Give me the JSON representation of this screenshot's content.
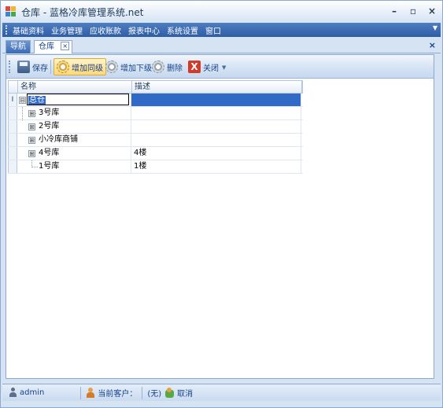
{
  "window": {
    "title": "仓库 - 蓝格冷库管理系统.net",
    "controls": {
      "minimize": "–",
      "restore": "▫",
      "close": "×"
    }
  },
  "menu": {
    "items": [
      "基础资料",
      "业务管理",
      "应收账款",
      "报表中心",
      "系统设置",
      "窗口"
    ],
    "overflow_icon": "chevron-down-icon"
  },
  "tabs": {
    "items": [
      {
        "label": "导航",
        "active": false
      },
      {
        "label": "仓库",
        "active": true
      }
    ],
    "close_glyph": "×",
    "strip_close_glyph": "×"
  },
  "toolbar": {
    "buttons": [
      {
        "label": "保存",
        "icon": "save-icon"
      },
      {
        "label": "增加同级",
        "icon": "gear-icon",
        "active": true
      },
      {
        "label": "增加下级",
        "icon": "gear-icon"
      },
      {
        "label": "删除",
        "icon": "gear-icon"
      },
      {
        "label": "关闭",
        "icon": "close-icon"
      }
    ],
    "close_glyph": "X",
    "dropdown_glyph": "▼"
  },
  "grid": {
    "columns": [
      "名称",
      "描述"
    ],
    "editing_marker": "I",
    "expander_glyph": "⊟",
    "collapsed_glyph": "⊞",
    "rows": [
      {
        "name": "总仓",
        "description": "",
        "level": 0,
        "selected": true,
        "editing": true,
        "expanded": true
      },
      {
        "name": "3号库",
        "description": "",
        "level": 1,
        "collapsed": true
      },
      {
        "name": "2号库",
        "description": "",
        "level": 1,
        "collapsed": true
      },
      {
        "name": "小冷库商铺",
        "description": "",
        "level": 1,
        "collapsed": true
      },
      {
        "name": "4号库",
        "description": "4楼",
        "level": 1,
        "collapsed": true
      },
      {
        "name": "1号库",
        "description": "1楼",
        "level": 1,
        "collapsed": false
      }
    ]
  },
  "status": {
    "user": "admin",
    "customer_label": "当前客户：",
    "customer_value": "(无)",
    "cancel_label": "取消"
  },
  "colors": {
    "menubar": "#2e5da6",
    "selection": "#3169c6",
    "accent_active": "#ffd87a"
  }
}
